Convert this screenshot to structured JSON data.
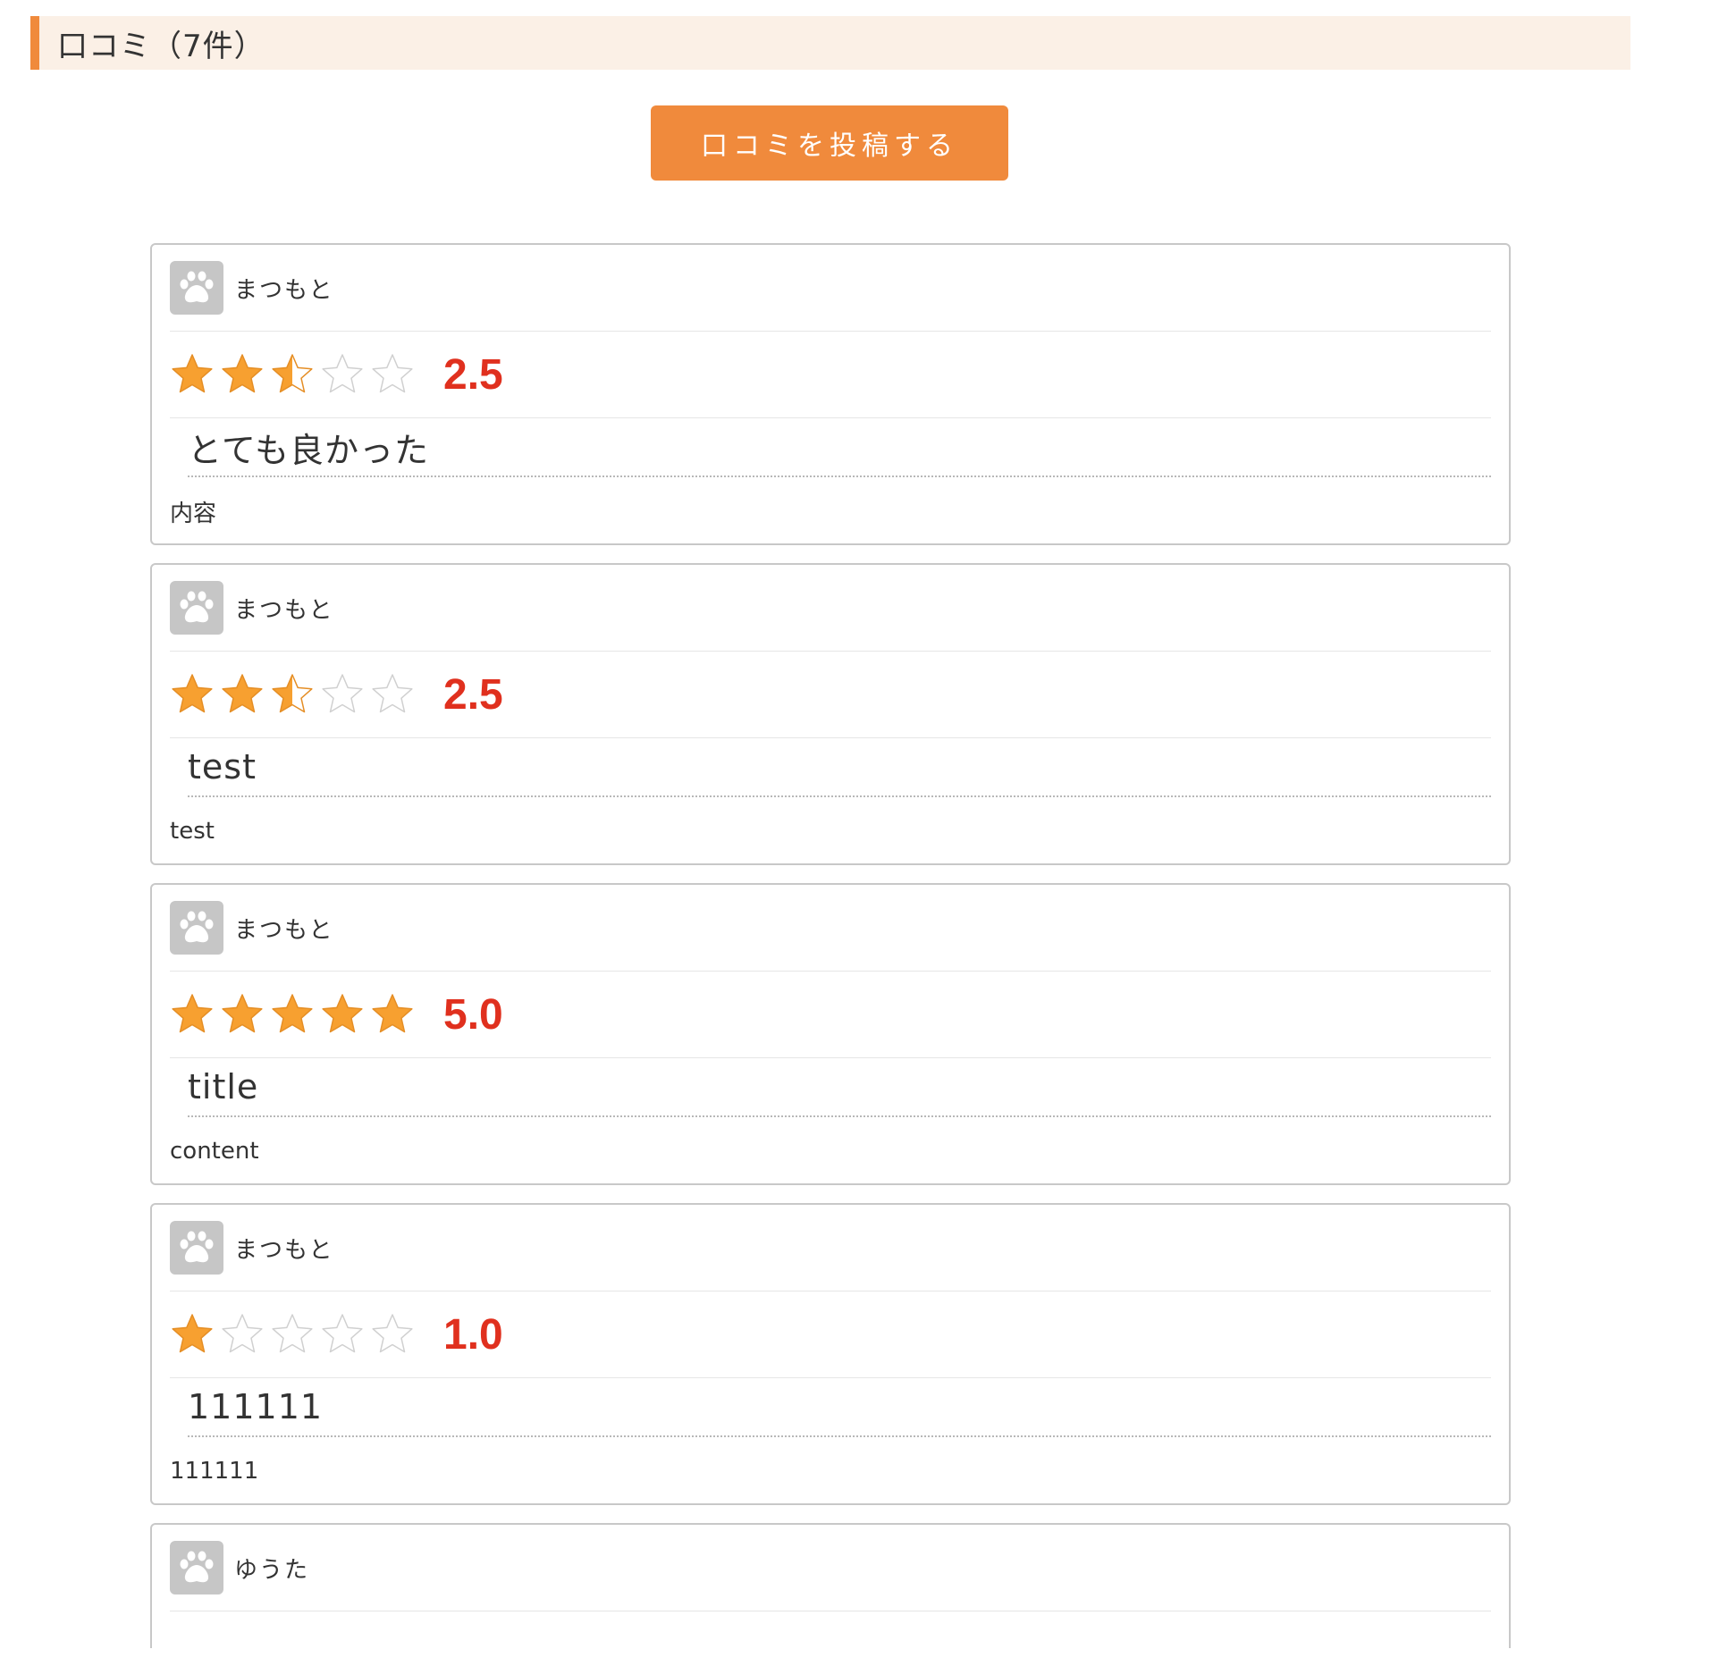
{
  "section": {
    "title": "口コミ（7件）"
  },
  "post_button_label": "口コミを投稿する",
  "avatar_icon": "paw-icon",
  "colors": {
    "accent": "#f08a3c",
    "header_bg": "#fbf0e6",
    "rating": "#e0301e",
    "star_filled": "#f7a030",
    "star_empty": "#ffffff"
  },
  "reviews": [
    {
      "user": "まつもと",
      "rating": 2.5,
      "rating_label": "2.5",
      "title": "とても良かった",
      "content": "内容"
    },
    {
      "user": "まつもと",
      "rating": 2.5,
      "rating_label": "2.5",
      "title": "test",
      "content": "test"
    },
    {
      "user": "まつもと",
      "rating": 5.0,
      "rating_label": "5.0",
      "title": "title",
      "content": "content"
    },
    {
      "user": "まつもと",
      "rating": 1.0,
      "rating_label": "1.0",
      "title": "111111",
      "content": "111111"
    },
    {
      "user": "ゆうた"
    }
  ]
}
